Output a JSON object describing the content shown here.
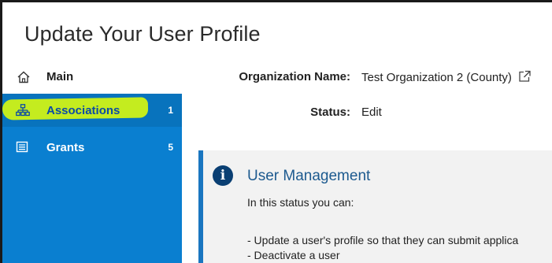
{
  "page": {
    "title": "Update Your User Profile"
  },
  "sidebar": {
    "main_label": "Main",
    "items": [
      {
        "label": "Associations",
        "count": "1",
        "icon": "sitemap-icon"
      },
      {
        "label": "Grants",
        "count": "5",
        "icon": "list-icon"
      }
    ]
  },
  "details": {
    "org_label": "Organization Name:",
    "org_value": "Test Organization 2 (County)",
    "status_label": "Status:",
    "status_value": "Edit"
  },
  "info": {
    "icon_text": "i",
    "title": "User Management",
    "intro": "In this status you can:",
    "bullets": [
      "- Update a user's profile so that they can submit applica",
      "- Deactivate a user"
    ]
  },
  "colors": {
    "sidebar_blue": "#0a7fd0",
    "highlight": "#c4ec1f",
    "info_accent": "#1a76c0"
  }
}
